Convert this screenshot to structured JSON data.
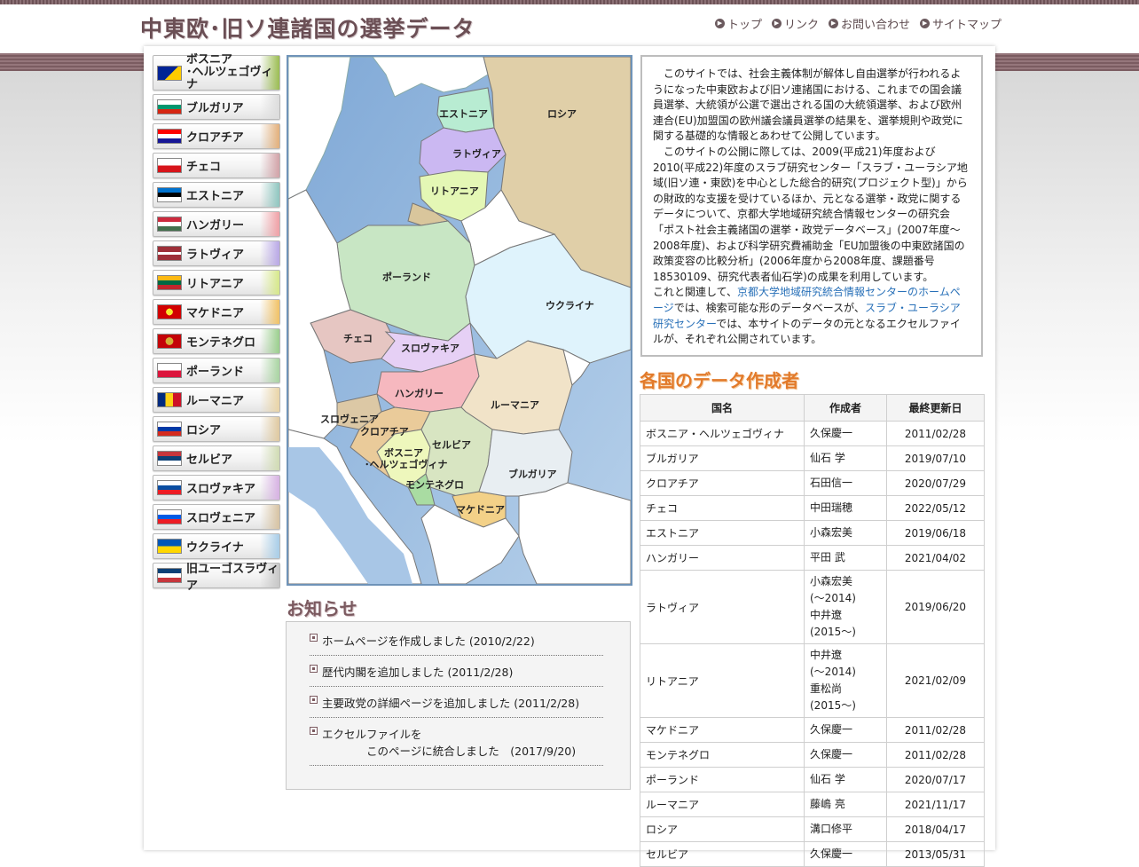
{
  "site": {
    "title": "中東欧･旧ソ連諸国の選挙データ"
  },
  "nav": [
    {
      "label": "トップ"
    },
    {
      "label": "リンク"
    },
    {
      "label": "お問い合わせ"
    },
    {
      "label": "サイトマップ"
    }
  ],
  "sidebar": [
    {
      "label1": "ボスニア",
      "label2": "･ヘルツェゴヴィナ",
      "accent": "#9bbd52",
      "flag": "bosnia"
    },
    {
      "label1": "ブルガリア",
      "accent": "#dcdcdc",
      "flag": "bulgaria"
    },
    {
      "label1": "クロアチア",
      "accent": "#e3b07b",
      "flag": "croatia"
    },
    {
      "label1": "チェコ",
      "accent": "#d2a3a8",
      "flag": "czech"
    },
    {
      "label1": "エストニア",
      "accent": "#8fc6c0",
      "flag": "estonia"
    },
    {
      "label1": "ハンガリー",
      "accent": "#f0a0a6",
      "flag": "hungary"
    },
    {
      "label1": "ラトヴィア",
      "accent": "#b9a8e6",
      "flag": "latvia"
    },
    {
      "label1": "リトアニア",
      "accent": "#d6e88a",
      "flag": "lithuania"
    },
    {
      "label1": "マケドニア",
      "accent": "#f1c266",
      "flag": "macedonia"
    },
    {
      "label1": "モンテネグロ",
      "accent": "#9bcf8e",
      "flag": "montenegro"
    },
    {
      "label1": "ポーランド",
      "accent": "#a9d4a2",
      "flag": "poland"
    },
    {
      "label1": "ルーマニア",
      "accent": "#e9d4a7",
      "flag": "romania"
    },
    {
      "label1": "ロシア",
      "accent": "#dfc9a0",
      "flag": "russia"
    },
    {
      "label1": "セルビア",
      "accent": "#d0dbb3",
      "flag": "serbia"
    },
    {
      "label1": "スロヴァキア",
      "accent": "#d7b2e3",
      "flag": "slovakia"
    },
    {
      "label1": "スロヴェニア",
      "accent": "#d7c3a3",
      "flag": "slovenia"
    },
    {
      "label1": "ウクライナ",
      "accent": "#a8cde8",
      "flag": "ukraine"
    },
    {
      "label1": "旧ユーゴスラヴィア",
      "accent": "#c7c7c7",
      "flag": "yugoslavia"
    }
  ],
  "map": {
    "labels": {
      "estonia": "エストニア",
      "russia": "ロシア",
      "latvia": "ラトヴィア",
      "lithuania": "リトアニア",
      "poland": "ポーランド",
      "ukraine": "ウクライナ",
      "czech": "チェコ",
      "slovakia": "スロヴァキア",
      "hungary": "ハンガリー",
      "romania": "ルーマニア",
      "slovenia": "スロヴェニア",
      "croatia": "クロアチア",
      "bosnia1": "ボスニア",
      "bosnia2": "･ヘルツェゴヴィナ",
      "serbia": "セルビア",
      "bulgaria": "ブルガリア",
      "montenegro": "モンテネグロ",
      "macedonia": "マケドニア"
    }
  },
  "intro": {
    "p1": "このサイトでは、社会主義体制が解体し自由選挙が行われるようになった中東欧および旧ソ連諸国における、これまでの国会議員選挙、大統領が公選で選出される国の大統領選挙、および欧州連合(EU)加盟国の欧州議会議員選挙の結果を、選挙規則や政党に関する基礎的な情報とあわせて公開しています。",
    "p2": "このサイトの公開に際しては、2009(平成21)年度および2010(平成22)年度のスラブ研究センター「スラブ・ユーラシア地域(旧ソ連・東欧)を中心とした総合的研究(プロジェクト型)」からの財政的な支援を受けているほか、元となる選挙・政党に関するデータについて、京都大学地域研究統合情報センターの研究会「ポスト社会主義諸国の選挙・政党データベース」(2007年度～2008年度)、および科学研究費補助金「EU加盟後の中東欧諸国の政策変容の比較分析」(2006年度から2008年度、課題番号18530109、研究代表者仙石学)の成果を利用しています。",
    "p3_before": "これと関連して、",
    "link1": "京都大学地域研究統合情報センターのホームページ",
    "p3_middle": "では、検索可能な形のデータベースが、",
    "link2": "スラブ・ユーラシア研究センター",
    "p3_after": "では、本サイトのデータの元となるエクセルファイルが、それぞれ公開されています。"
  },
  "makers": {
    "heading": "各国のデータ作成者",
    "headers": {
      "country": "国名",
      "author": "作成者",
      "updated": "最終更新日"
    },
    "rows": [
      {
        "country": "ボスニア・ヘルツェゴヴィナ",
        "author": [
          "久保慶一"
        ],
        "date": "2011/02/28"
      },
      {
        "country": "ブルガリア",
        "author": [
          "仙石 学"
        ],
        "date": "2019/07/10"
      },
      {
        "country": "クロアチア",
        "author": [
          "石田信一"
        ],
        "date": "2020/07/29"
      },
      {
        "country": "チェコ",
        "author": [
          "中田瑞穂"
        ],
        "date": "2022/05/12"
      },
      {
        "country": "エストニア",
        "author": [
          "小森宏美"
        ],
        "date": "2019/06/18"
      },
      {
        "country": "ハンガリー",
        "author": [
          "平田 武"
        ],
        "date": "2021/04/02"
      },
      {
        "country": "ラトヴィア",
        "author": [
          "小森宏美",
          "(～2014)",
          "中井遼",
          "(2015～)"
        ],
        "date": "2019/06/20"
      },
      {
        "country": "リトアニア",
        "author": [
          "中井遼",
          "(～2014)",
          "重松尚",
          "(2015～)"
        ],
        "date": "2021/02/09"
      },
      {
        "country": "マケドニア",
        "author": [
          "久保慶一"
        ],
        "date": "2011/02/28"
      },
      {
        "country": "モンテネグロ",
        "author": [
          "久保慶一"
        ],
        "date": "2011/02/28"
      },
      {
        "country": "ポーランド",
        "author": [
          "仙石 学"
        ],
        "date": "2020/07/17"
      },
      {
        "country": "ルーマニア",
        "author": [
          "藤嶋 亮"
        ],
        "date": "2021/11/17"
      },
      {
        "country": "ロシア",
        "author": [
          "溝口修平"
        ],
        "date": "2018/04/17"
      },
      {
        "country": "セルビア",
        "author": [
          "久保慶一"
        ],
        "date": "2013/05/31"
      }
    ]
  },
  "news": {
    "heading": "お知らせ",
    "items": [
      {
        "line1": "ホームページを作成しました (2010/2/22)"
      },
      {
        "line1": "歴代内閣を追加しました (2011/2/28)"
      },
      {
        "line1": "主要政党の詳細ページを追加しました (2011/2/28)"
      },
      {
        "line1": "エクセルファイルを",
        "line2": "このページに統合しました　(2017/9/20)"
      }
    ]
  }
}
